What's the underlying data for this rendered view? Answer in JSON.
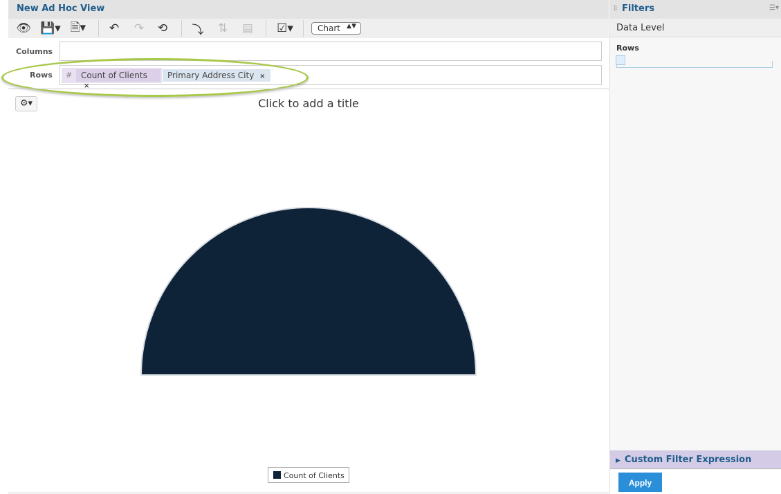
{
  "header": {
    "title": "New Ad Hoc View"
  },
  "toolbar": {
    "view_type": "Chart"
  },
  "fields": {
    "columns_label": "Columns",
    "rows_label": "Rows",
    "rows": [
      {
        "label": "Count of Clients",
        "type": "measure",
        "symbol": "#",
        "color": "#dccfe8"
      },
      {
        "label": "Primary Address City",
        "type": "dimension",
        "color": "#dbe5ef"
      }
    ],
    "remove_glyph": "×"
  },
  "chart_area": {
    "title_placeholder": "Click to add a title"
  },
  "chart_data": {
    "type": "pie",
    "variant": "semi-circle",
    "series": [
      {
        "name": "Count of Clients",
        "color": "#0f2338",
        "share_percent": 100
      }
    ],
    "legend": "bottom"
  },
  "filters": {
    "title": "Filters",
    "data_level": "Data Level",
    "rows_label": "Rows",
    "custom_filter": "Custom Filter Expression",
    "apply_label": "Apply"
  }
}
